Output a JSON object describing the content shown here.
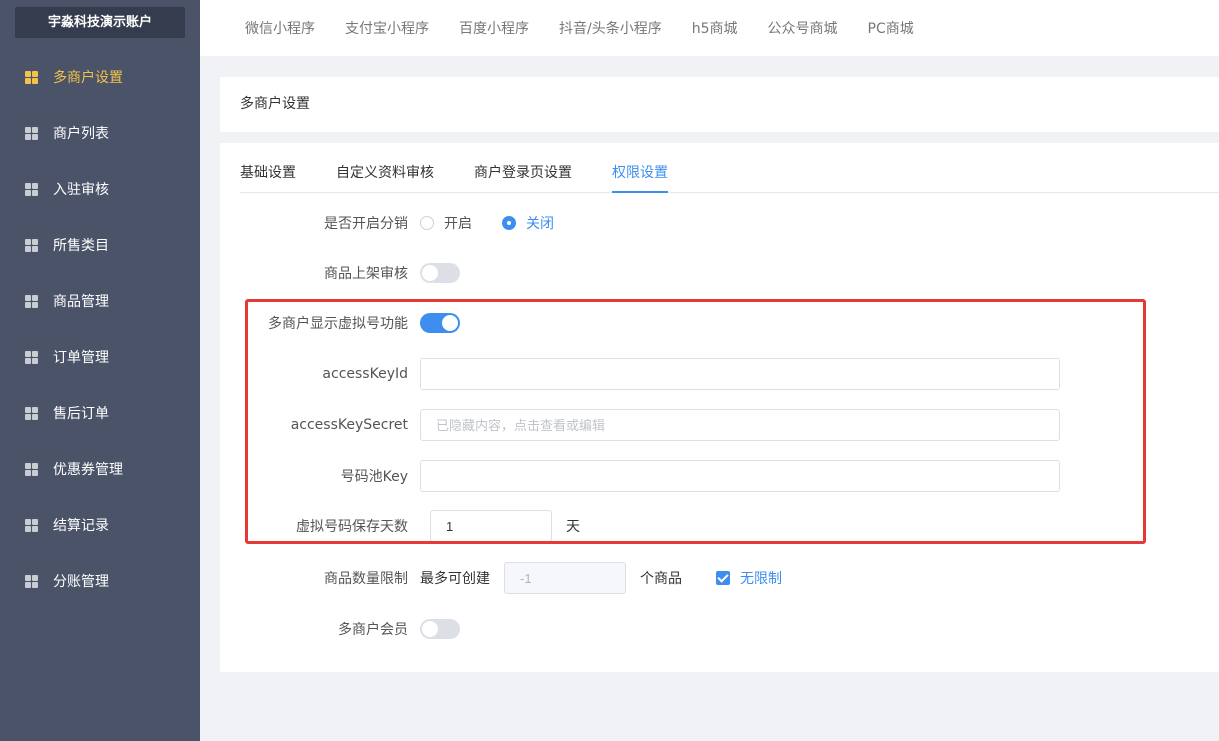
{
  "sidebar": {
    "account": "宇淼科技演示账户",
    "items": [
      {
        "label": "多商户设置",
        "active": true
      },
      {
        "label": "商户列表"
      },
      {
        "label": "入驻审核"
      },
      {
        "label": "所售类目"
      },
      {
        "label": "商品管理"
      },
      {
        "label": "订单管理"
      },
      {
        "label": "售后订单"
      },
      {
        "label": "优惠券管理"
      },
      {
        "label": "结算记录"
      },
      {
        "label": "分账管理"
      }
    ]
  },
  "topbar": {
    "tabs": [
      "微信小程序",
      "支付宝小程序",
      "百度小程序",
      "抖音/头条小程序",
      "h5商城",
      "公众号商城",
      "PC商城"
    ]
  },
  "page": {
    "title": "多商户设置"
  },
  "tabs": [
    "基础设置",
    "自定义资料审核",
    "商户登录页设置",
    "权限设置"
  ],
  "active_tab": "权限设置",
  "form": {
    "distribution": {
      "label": "是否开启分销",
      "options": [
        "开启",
        "关闭"
      ],
      "selected": "关闭"
    },
    "product_review": {
      "label": "商品上架审核",
      "enabled": false
    },
    "virtual_number": {
      "label": "多商户显示虚拟号功能",
      "enabled": true
    },
    "access_key_id": {
      "label": "accessKeyId",
      "value": "",
      "placeholder": ""
    },
    "access_key_secret": {
      "label": "accessKeySecret",
      "value": "",
      "placeholder": "已隐藏内容，点击查看或编辑"
    },
    "pool_key": {
      "label": "号码池Key",
      "value": "",
      "placeholder": ""
    },
    "retention_days": {
      "label": "虚拟号码保存天数",
      "value": "1",
      "unit": "天"
    },
    "product_limit": {
      "label": "商品数量限制",
      "prefix": "最多可创建",
      "value": "-1",
      "unit": "个商品",
      "unlimited_label": "无限制",
      "unlimited": true
    },
    "member": {
      "label": "多商户会员",
      "enabled": false
    }
  },
  "colors": {
    "accent": "#3d8eef",
    "sidebar_bg": "#4a5367",
    "active_menu": "#f3c24b",
    "highlight": "#e53935"
  }
}
